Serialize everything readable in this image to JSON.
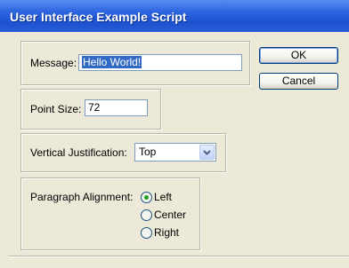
{
  "window": {
    "title": "User Interface Example Script"
  },
  "message": {
    "label": "Message:",
    "value": "Hello World!"
  },
  "point_size": {
    "label": "Point Size:",
    "value": "72"
  },
  "vertical_justification": {
    "label": "Vertical Justification:",
    "selected": "Top"
  },
  "paragraph_alignment": {
    "label": "Paragraph Alignment:",
    "options": [
      "Left",
      "Center",
      "Right"
    ],
    "selected": "Left"
  },
  "buttons": {
    "ok": "OK",
    "cancel": "Cancel"
  },
  "colors": {
    "titlebar": "#2e66e0",
    "dialog_bg": "#ECE9D8",
    "selection": "#316ac5",
    "radio_dot": "#21a121"
  },
  "icons": {
    "dropdown": "chevron-down-icon"
  }
}
